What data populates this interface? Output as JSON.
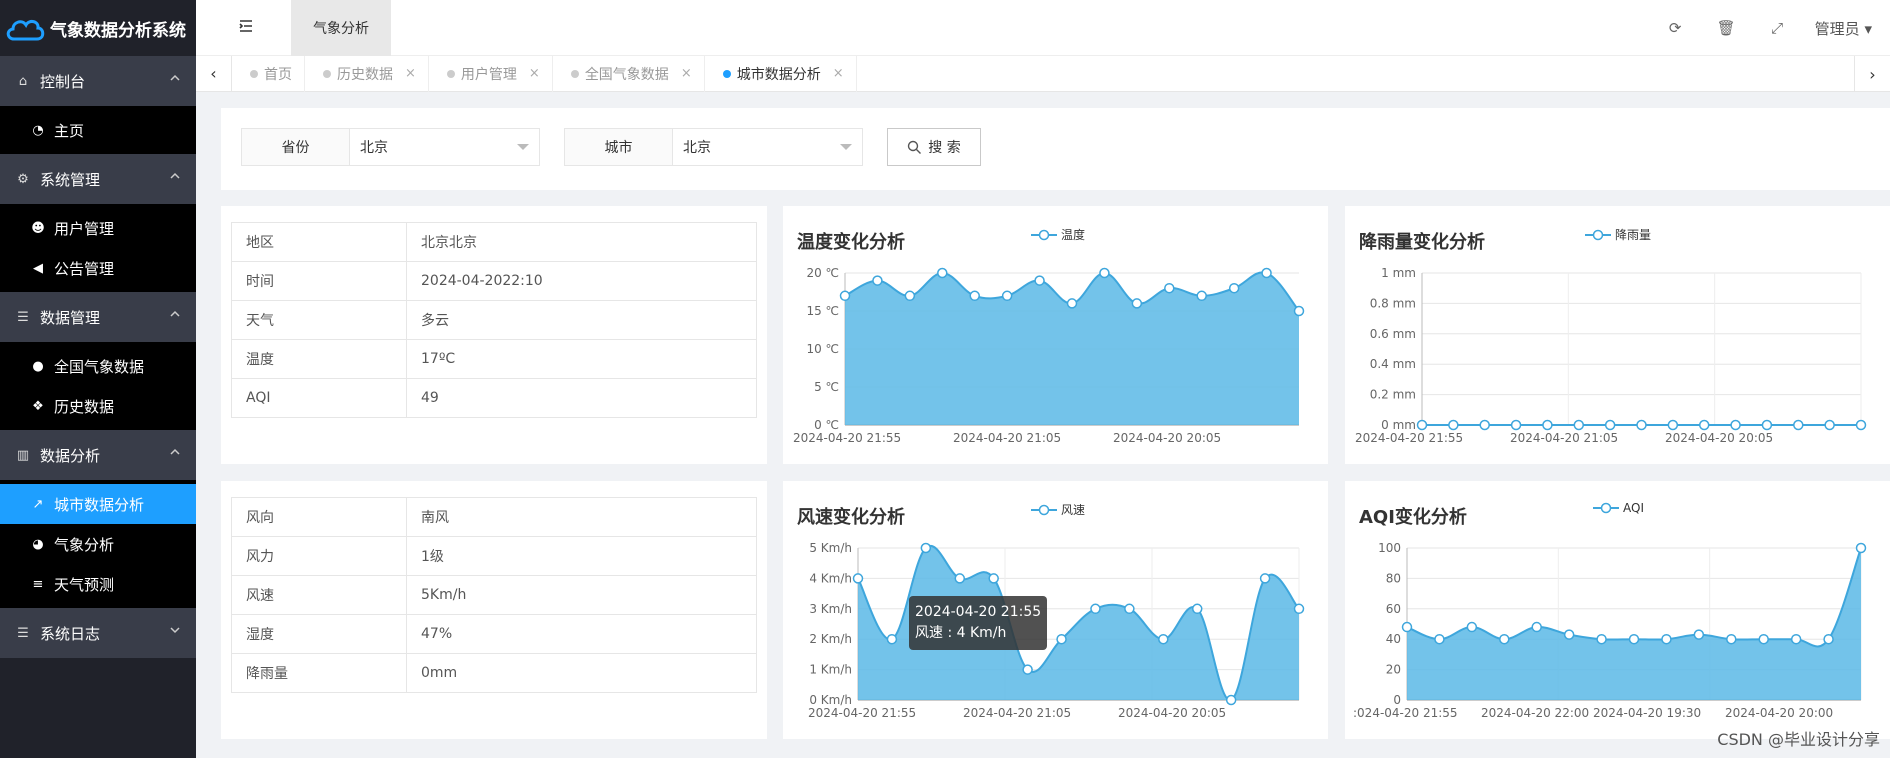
{
  "app": {
    "title": "气象数据分析系统"
  },
  "sidebar": {
    "groups": [
      {
        "label": "控制台",
        "icon": "home-icon",
        "items": [
          {
            "label": "主页",
            "icon": "dashboard-icon"
          }
        ]
      },
      {
        "label": "系统管理",
        "icon": "gears-icon",
        "items": [
          {
            "label": "用户管理",
            "icon": "users-icon"
          },
          {
            "label": "公告管理",
            "icon": "speaker-icon"
          }
        ]
      },
      {
        "label": "数据管理",
        "icon": "server-icon",
        "items": [
          {
            "label": "全国气象数据",
            "icon": "globe-icon"
          },
          {
            "label": "历史数据",
            "icon": "cubes-icon"
          }
        ]
      },
      {
        "label": "数据分析",
        "icon": "bar-chart-icon",
        "items": [
          {
            "label": "城市数据分析",
            "icon": "line-chart-icon",
            "active": true
          },
          {
            "label": "气象分析",
            "icon": "pie-chart-icon"
          },
          {
            "label": "天气预测",
            "icon": "database-icon"
          }
        ]
      },
      {
        "label": "系统日志",
        "icon": "server-icon",
        "items": []
      }
    ]
  },
  "header": {
    "tab": "气象分析",
    "user": "管理员"
  },
  "tabs": [
    {
      "label": "首页",
      "closable": false
    },
    {
      "label": "历史数据",
      "closable": true
    },
    {
      "label": "用户管理",
      "closable": true
    },
    {
      "label": "全国气象数据",
      "closable": true
    },
    {
      "label": "城市数据分析",
      "closable": true,
      "active": true
    }
  ],
  "search": {
    "province_label": "省份",
    "province_value": "北京",
    "city_label": "城市",
    "city_value": "北京",
    "button_label": "搜 索"
  },
  "info1": [
    {
      "k": "地区",
      "v": "北京北京"
    },
    {
      "k": "时间",
      "v": "2024-04-2022:10"
    },
    {
      "k": "天气",
      "v": "多云"
    },
    {
      "k": "温度",
      "v": "17ºC"
    },
    {
      "k": "AQI",
      "v": "49"
    }
  ],
  "info2": [
    {
      "k": "风向",
      "v": "南风"
    },
    {
      "k": "风力",
      "v": "1级"
    },
    {
      "k": "风速",
      "v": "5Km/h"
    },
    {
      "k": "湿度",
      "v": "47%"
    },
    {
      "k": "降雨量",
      "v": "0mm"
    }
  ],
  "chart_data": [
    {
      "id": "temp",
      "type": "area",
      "title": "温度变化分析",
      "series": [
        {
          "name": "温度",
          "values": [
            17,
            19,
            17,
            20,
            17,
            17,
            19,
            16,
            20,
            16,
            18,
            17,
            18,
            20,
            15
          ]
        }
      ],
      "y_ticks": [
        "0 ℃",
        "5 ℃",
        "10 ℃",
        "15 ℃",
        "20 ℃"
      ],
      "ylim": [
        0,
        20
      ],
      "x_labels": [
        "2024-04-20 21:55",
        "2024-04-20 21:05",
        "2024-04-20 20:05"
      ],
      "grid": true,
      "legend": "top"
    },
    {
      "id": "rain",
      "type": "line",
      "title": "降雨量变化分析",
      "series": [
        {
          "name": "降雨量",
          "values": [
            0,
            0,
            0,
            0,
            0,
            0,
            0,
            0,
            0,
            0,
            0,
            0,
            0,
            0,
            0
          ]
        }
      ],
      "y_ticks": [
        "0 mm",
        "0.2 mm",
        "0.4 mm",
        "0.6 mm",
        "0.8 mm",
        "1 mm"
      ],
      "ylim": [
        0,
        1
      ],
      "x_labels": [
        "2024-04-20 21:55",
        "2024-04-20 21:05",
        "2024-04-20 20:05"
      ],
      "grid": true,
      "legend": "top"
    },
    {
      "id": "wind",
      "type": "area",
      "title": "风速变化分析",
      "series": [
        {
          "name": "风速",
          "values": [
            4,
            2,
            5,
            4,
            4,
            1,
            2,
            3,
            3,
            2,
            3,
            0,
            4,
            3
          ]
        }
      ],
      "y_ticks": [
        "0 Km/h",
        "1 Km/h",
        "2 Km/h",
        "3 Km/h",
        "4 Km/h",
        "5 Km/h"
      ],
      "ylim": [
        0,
        5
      ],
      "x_labels": [
        "2024-04-20 21:55",
        "2024-04-20 21:05",
        "2024-04-20 20:05"
      ],
      "tooltip": {
        "title": "2024-04-20 21:55",
        "line": "风速 : 4 Km/h"
      },
      "grid": true,
      "legend": "top"
    },
    {
      "id": "aqi",
      "type": "area",
      "title": "AQI变化分析",
      "series": [
        {
          "name": "AQI",
          "values": [
            48,
            40,
            48,
            40,
            48,
            43,
            40,
            40,
            40,
            43,
            40,
            40,
            40,
            40,
            100
          ]
        }
      ],
      "y_ticks": [
        "0",
        "20",
        "40",
        "60",
        "80",
        "100"
      ],
      "ylim": [
        0,
        100
      ],
      "x_labels": [
        ":024-04-20 21:55",
        "2024-04-20 22:00",
        "2024-04-20 19:30",
        "2024-04-20 20:00"
      ],
      "grid": true,
      "legend": "top"
    }
  ],
  "watermark": "CSDN @毕业设计分享",
  "colors": {
    "accent": "#1e9fff",
    "area": "#5ab8e6",
    "line": "#3ea6dc"
  }
}
